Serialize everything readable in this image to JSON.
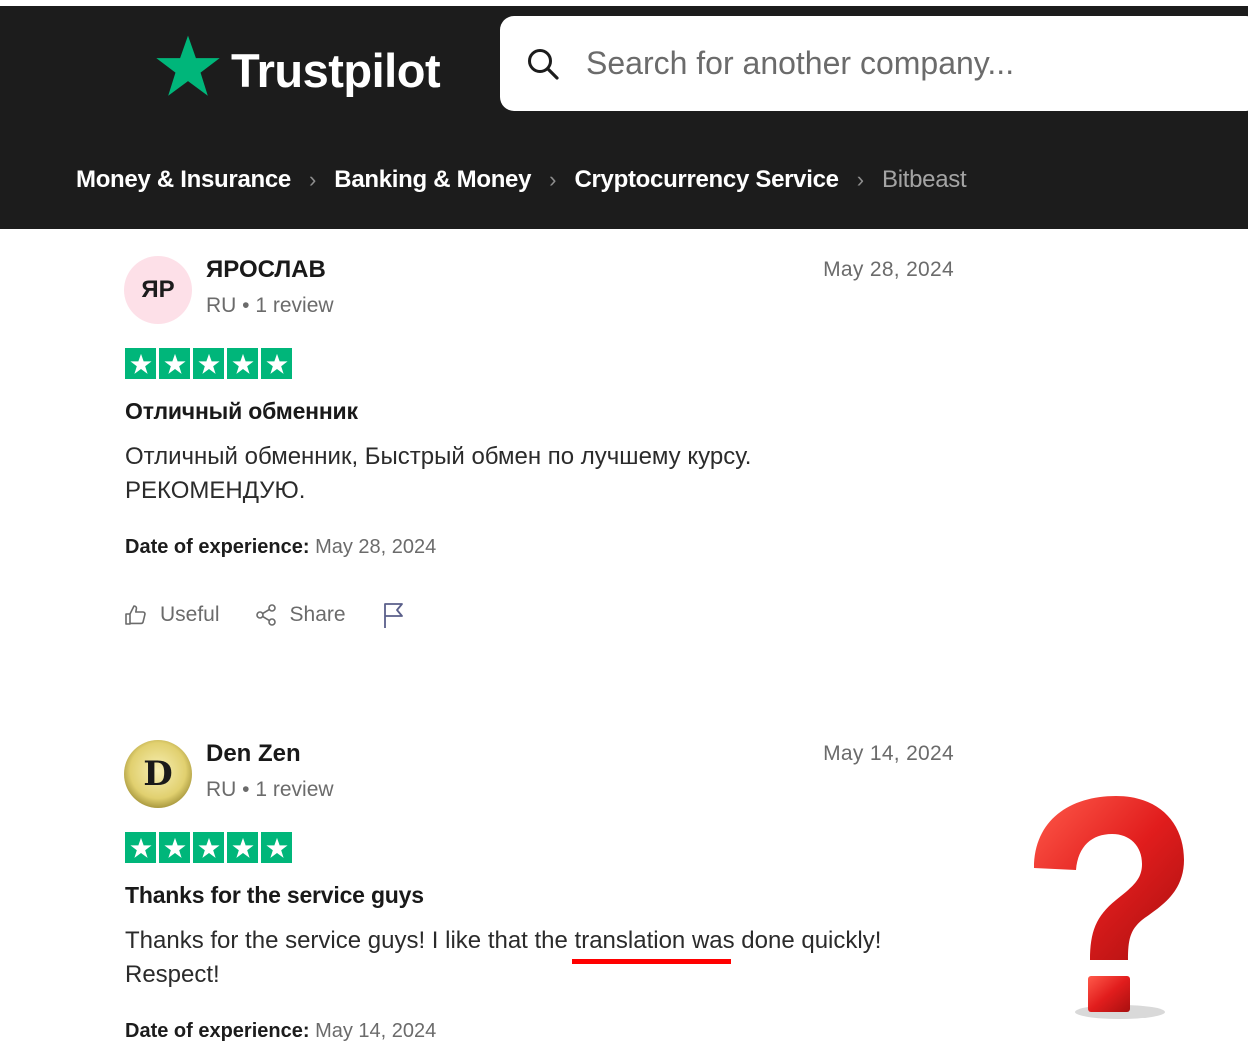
{
  "header": {
    "brand": "Trustpilot",
    "search_placeholder": "Search for another company..."
  },
  "breadcrumb": [
    "Money & Insurance",
    "Banking & Money",
    "Cryptocurrency Service",
    "Bitbeast"
  ],
  "reviews": [
    {
      "avatar_initials": "ЯР",
      "name": "ЯРОСЛАВ",
      "meta": "RU • 1 review",
      "date": "May 28, 2024",
      "rating": 5,
      "title": "Отличный обменник",
      "text_line1": "Отличный обменник, Быстрый обмен по лучшему курсу.",
      "text_line2": "РЕКОМЕНДУЮ.",
      "experience_label": "Date of experience:",
      "experience_date": "May 28, 2024"
    },
    {
      "avatar_initials": "D",
      "name": "Den Zen",
      "meta": "RU • 1 review",
      "date": "May 14, 2024",
      "rating": 5,
      "title": "Thanks for the service guys",
      "text_line1": "Thanks for the service guys! I like that the translation was done quickly!",
      "text_line2": "Respect!",
      "experience_label": "Date of experience:",
      "experience_date": "May 14, 2024"
    }
  ],
  "actions": {
    "useful": "Useful",
    "share": "Share"
  },
  "colors": {
    "header_bg": "#1c1c1c",
    "star_green": "#00b67a",
    "annotation_red": "#e11d1d"
  },
  "icons": [
    "trustpilot-star-icon",
    "search-icon",
    "chevron-right-icon",
    "thumbs-up-icon",
    "share-icon",
    "flag-icon",
    "question-mark-icon"
  ]
}
